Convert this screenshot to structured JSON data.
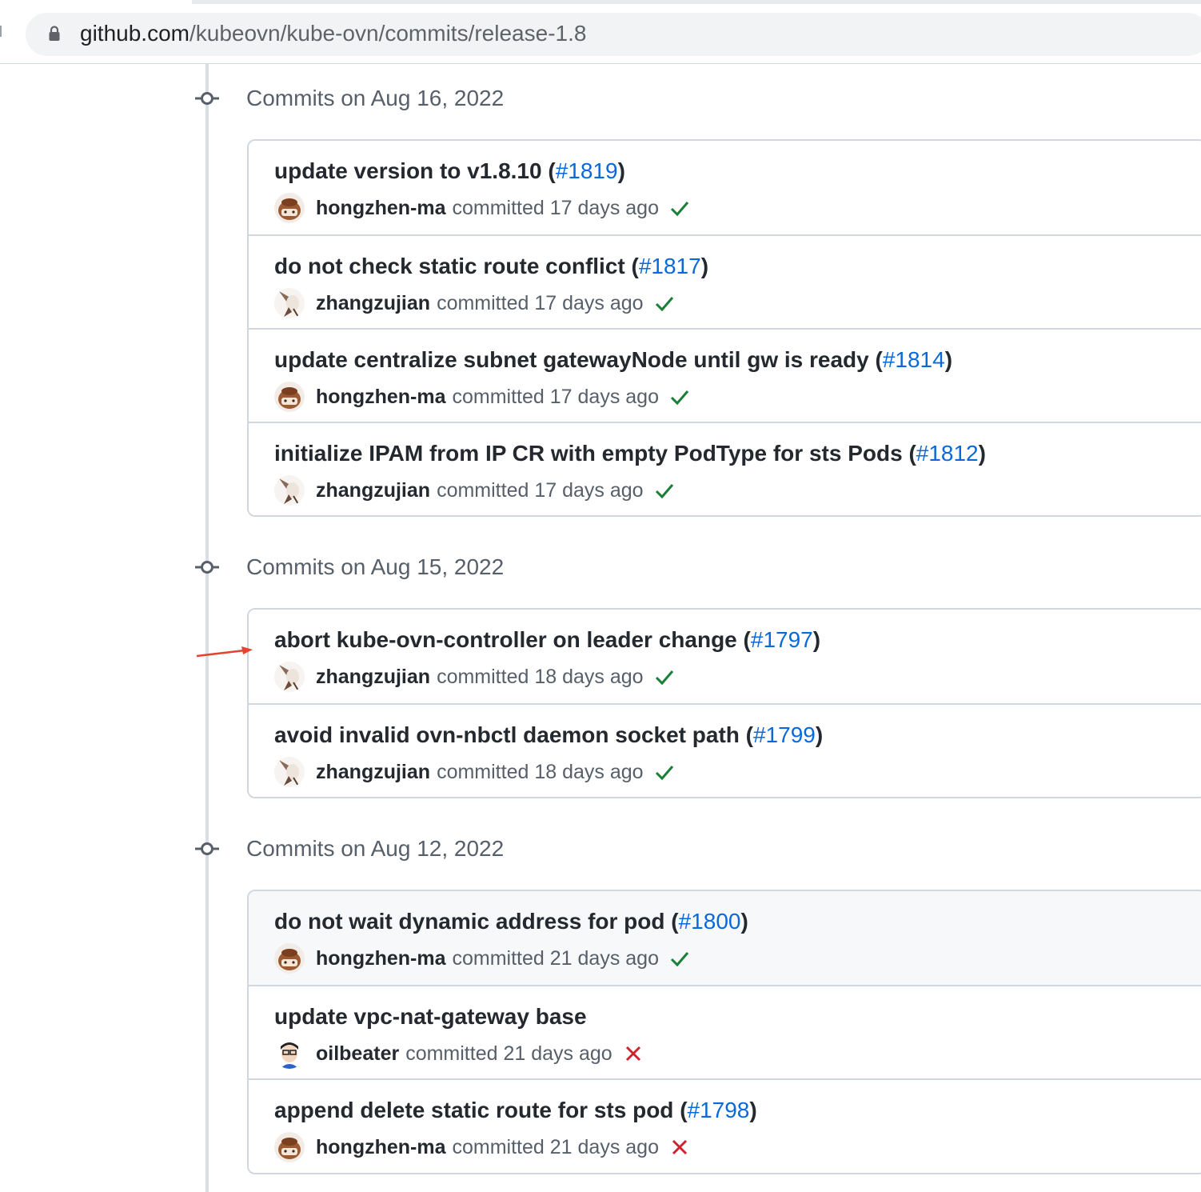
{
  "browser": {
    "url_host": "github.com",
    "url_path": "/kubeovn/kube-ovn/commits/release-1.8"
  },
  "days": [
    {
      "title": "Commits on Aug 16, 2022",
      "commits": [
        {
          "message": "update version to v1.8.10",
          "pr": "#1819",
          "author": "hongzhen-ma",
          "when": "committed 17 days ago",
          "status": "success",
          "avatar": "hongzhen-ma"
        },
        {
          "message": "do not check static route conflict",
          "pr": "#1817",
          "author": "zhangzujian",
          "when": "committed 17 days ago",
          "status": "success",
          "avatar": "zhangzujian"
        },
        {
          "message": "update centralize subnet gatewayNode until gw is ready",
          "pr": "#1814",
          "author": "hongzhen-ma",
          "when": "committed 17 days ago",
          "status": "success",
          "avatar": "hongzhen-ma"
        },
        {
          "message": "initialize IPAM from IP CR with empty PodType for sts Pods",
          "pr": "#1812",
          "author": "zhangzujian",
          "when": "committed 17 days ago",
          "status": "success",
          "avatar": "zhangzujian"
        }
      ]
    },
    {
      "title": "Commits on Aug 15, 2022",
      "commits": [
        {
          "message": "abort kube-ovn-controller on leader change",
          "pr": "#1797",
          "author": "zhangzujian",
          "when": "committed 18 days ago",
          "status": "success",
          "avatar": "zhangzujian"
        },
        {
          "message": "avoid invalid ovn-nbctl daemon socket path",
          "pr": "#1799",
          "author": "zhangzujian",
          "when": "committed 18 days ago",
          "status": "success",
          "avatar": "zhangzujian"
        }
      ]
    },
    {
      "title": "Commits on Aug 12, 2022",
      "commits": [
        {
          "message": "do not wait dynamic address for pod",
          "pr": "#1800",
          "author": "hongzhen-ma",
          "when": "committed 21 days ago",
          "status": "success",
          "avatar": "hongzhen-ma"
        },
        {
          "message": "update vpc-nat-gateway base",
          "pr": "",
          "author": "oilbeater",
          "when": "committed 21 days ago",
          "status": "failure",
          "avatar": "oilbeater"
        },
        {
          "message": "append delete static route for sts pod",
          "pr": "#1798",
          "author": "hongzhen-ma",
          "when": "committed 21 days ago",
          "status": "failure",
          "avatar": "hongzhen-ma"
        }
      ]
    }
  ],
  "colors": {
    "link": "#0969da",
    "success": "#1a7f37",
    "failure": "#cf222e",
    "annotation_arrow": "#e5432f"
  }
}
